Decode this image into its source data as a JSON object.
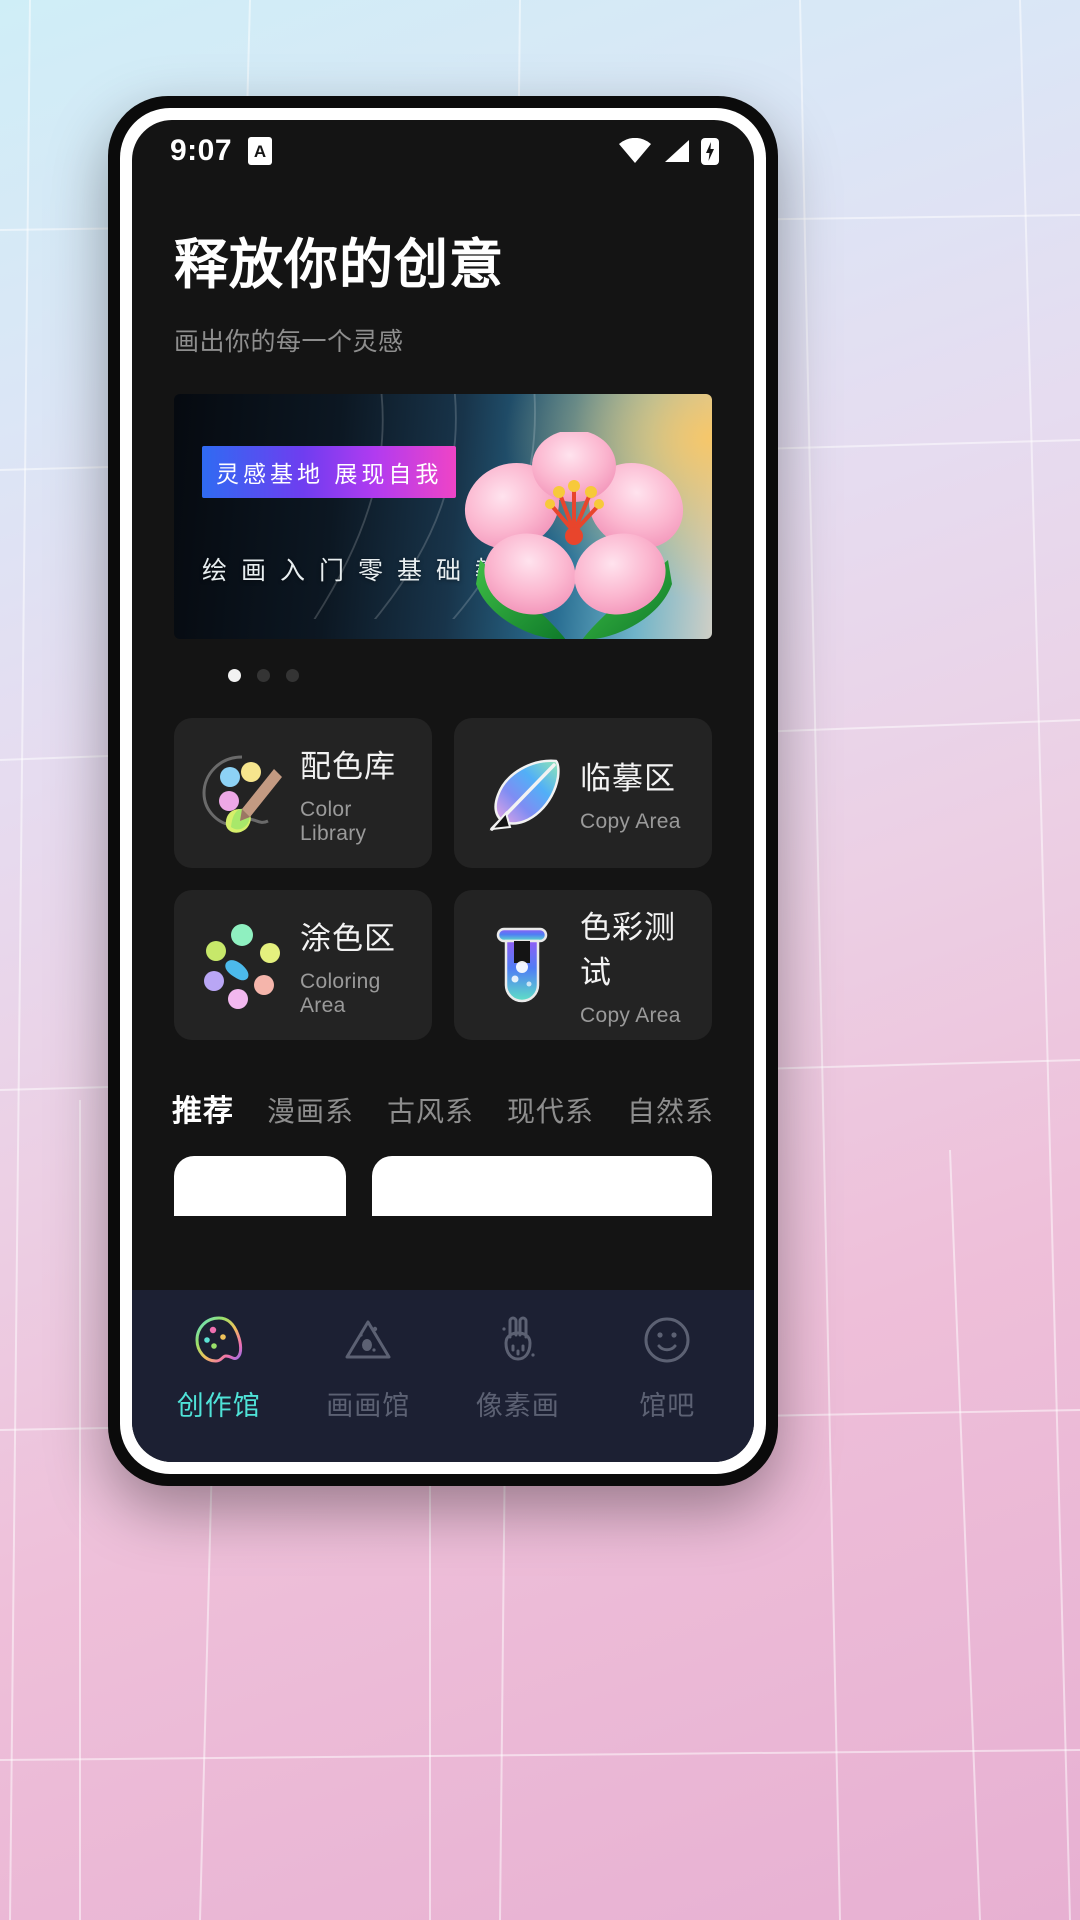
{
  "status_bar": {
    "time": "9:07",
    "app_badge": "A",
    "icons": [
      "wifi-icon",
      "signal-icon",
      "battery-icon"
    ]
  },
  "hero": {
    "title": "释放你的创意",
    "subtitle": "画出你的每一个灵感"
  },
  "banner": {
    "badge": "灵感基地 展现自我",
    "caption": "绘画入门零基础教程",
    "illustration": "pink-flower-illustration",
    "carousel": {
      "total": 3,
      "active_index": 0
    }
  },
  "features": [
    {
      "cn": "配色库",
      "en": "Color Library",
      "icon": "palette-brush-icon"
    },
    {
      "cn": "临摹区",
      "en": "Copy Area",
      "icon": "feather-quill-icon"
    },
    {
      "cn": "涂色区",
      "en": "Coloring Area",
      "icon": "color-dots-icon"
    },
    {
      "cn": "色彩测试",
      "en": "Copy Area",
      "icon": "test-tube-icon"
    }
  ],
  "category_tabs": [
    {
      "label": "推荐",
      "active": true
    },
    {
      "label": "漫画系",
      "active": false
    },
    {
      "label": "古风系",
      "active": false
    },
    {
      "label": "现代系",
      "active": false
    },
    {
      "label": "自然系",
      "active": false
    }
  ],
  "bottom_nav": [
    {
      "label": "创作馆",
      "icon": "palette-icon",
      "active": true
    },
    {
      "label": "画画馆",
      "icon": "triangle-icon",
      "active": false
    },
    {
      "label": "像素画",
      "icon": "bunny-icon",
      "active": false
    },
    {
      "label": "馆吧",
      "icon": "smiley-icon",
      "active": false
    }
  ],
  "colors": {
    "screen_bg": "#141414",
    "card_bg": "#232323",
    "nav_bg": "#1c2033",
    "accent": "#4fe3d8",
    "muted_text": "#8e8e8e"
  }
}
